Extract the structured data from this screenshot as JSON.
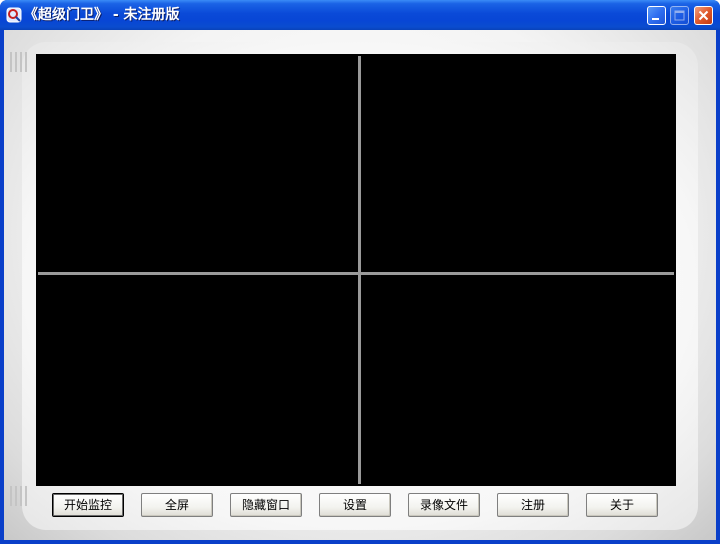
{
  "window": {
    "title": "《超级门卫》 - 未注册版",
    "title_bar_color": "#0a4ad8",
    "close_button_color": "#e05a2c",
    "controls": {
      "minimize_icon": "minimize-icon",
      "maximize_icon": "maximize-icon",
      "close_icon": "close-icon"
    }
  },
  "video": {
    "layout": "2x2",
    "background_color": "#000000",
    "divider_color": "#9a9a9a"
  },
  "toolbar": {
    "buttons": [
      {
        "label": "开始监控"
      },
      {
        "label": "全屏"
      },
      {
        "label": "隐藏窗口"
      },
      {
        "label": "设置"
      },
      {
        "label": "录像文件"
      },
      {
        "label": "注册"
      },
      {
        "label": "关于"
      }
    ]
  }
}
